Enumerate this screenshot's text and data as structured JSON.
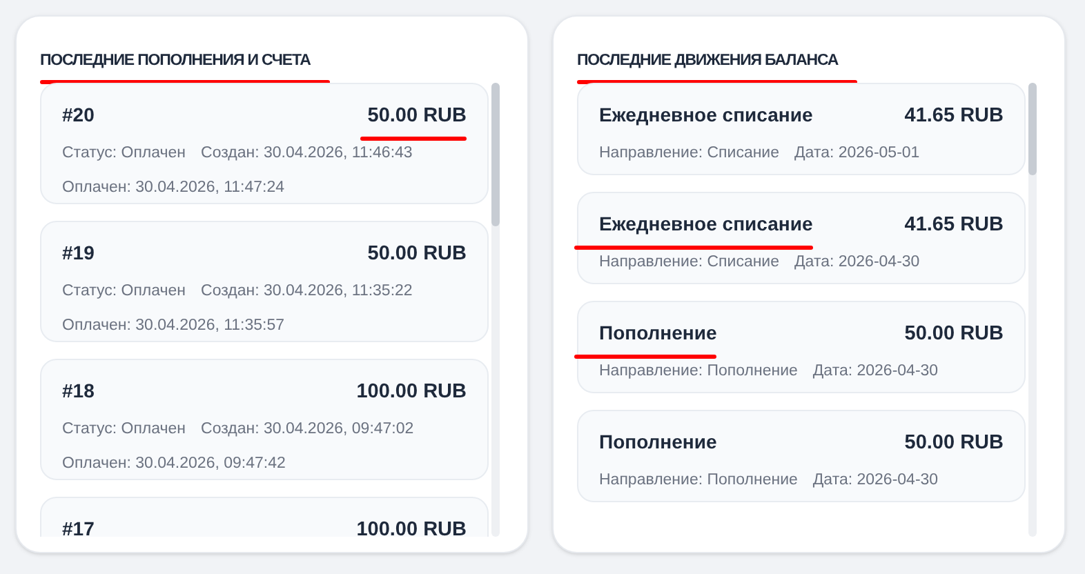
{
  "panels": [
    {
      "title": "ПОСЛЕДНИЕ ПОПОЛНЕНИЯ И СЧЕТА",
      "title_underlined": true,
      "kind": "invoices",
      "items": [
        {
          "title": "#20",
          "amount": "50.00 RUB",
          "amount_underlined": true,
          "lines": [
            [
              "Статус: Оплачен",
              "Создан: 30.04.2026, 11:46:43"
            ],
            [
              "Оплачен: 30.04.2026, 11:47:24"
            ]
          ]
        },
        {
          "title": "#19",
          "amount": "50.00 RUB",
          "lines": [
            [
              "Статус: Оплачен",
              "Создан: 30.04.2026, 11:35:22"
            ],
            [
              "Оплачен: 30.04.2026, 11:35:57"
            ]
          ]
        },
        {
          "title": "#18",
          "amount": "100.00 RUB",
          "lines": [
            [
              "Статус: Оплачен",
              "Создан: 30.04.2026, 09:47:02"
            ],
            [
              "Оплачен: 30.04.2026, 09:47:42"
            ]
          ]
        },
        {
          "title": "#17",
          "amount": "100.00 RUB"
        }
      ]
    },
    {
      "title": "ПОСЛЕДНИЕ ДВИЖЕНИЯ БАЛАНСА",
      "title_underlined": true,
      "kind": "movements",
      "items": [
        {
          "title": "Ежедневное списание",
          "amount": "41.65 RUB",
          "lines": [
            [
              "Направление: Списание",
              "Дата: 2026-05-01"
            ]
          ]
        },
        {
          "title": "Ежедневное списание",
          "title_underlined": true,
          "amount": "41.65 RUB",
          "lines": [
            [
              "Направление: Списание",
              "Дата: 2026-04-30"
            ]
          ]
        },
        {
          "title": "Пополнение",
          "title_underlined": true,
          "amount": "50.00 RUB",
          "lines": [
            [
              "Направление: Пополнение",
              "Дата: 2026-04-30"
            ]
          ]
        },
        {
          "title": "Пополнение",
          "amount": "50.00 RUB",
          "lines": [
            [
              "Направление: Пополнение",
              "Дата: 2026-04-30"
            ]
          ]
        }
      ]
    }
  ]
}
